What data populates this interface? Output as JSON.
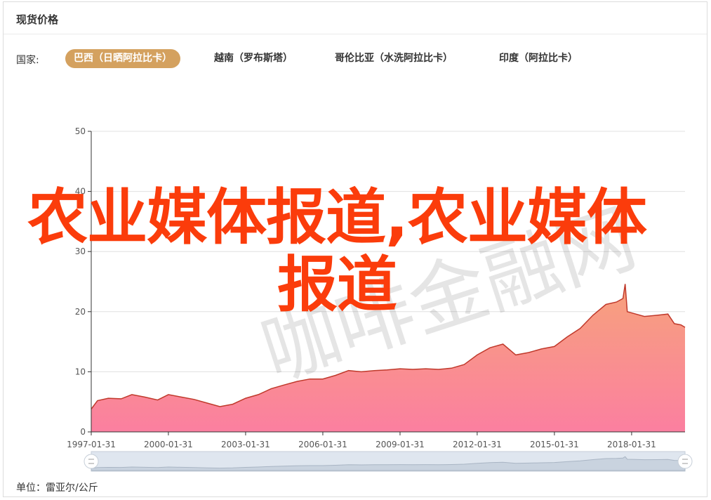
{
  "header": {
    "title": "现货价格"
  },
  "filters": {
    "label": "国家:",
    "tabs": [
      {
        "label": "巴西（日晒阿拉比卡）",
        "active": true
      },
      {
        "label": "越南（罗布斯塔）",
        "active": false
      },
      {
        "label": "哥伦比亚（水洗阿拉比卡）",
        "active": false
      },
      {
        "label": "印度（阿拉比卡）",
        "active": false
      }
    ]
  },
  "footer": {
    "unit": "单位：雷亚尔/公斤"
  },
  "overlay_text": "农业媒体报道,农业媒体报道",
  "watermark_text": "咖啡金融网",
  "colors": {
    "accent": "#d4a15f",
    "area_top": "#f7a27c",
    "area_bottom": "#fb7fa0",
    "line": "#c0392b",
    "overlay": "#fb3c0b"
  },
  "chart_data": {
    "type": "area",
    "ylim": [
      0,
      50
    ],
    "yticks": [
      0,
      10,
      20,
      30,
      40,
      50
    ],
    "xticks": [
      "1997-01-31",
      "2000-01-31",
      "2003-01-31",
      "2006-01-31",
      "2009-01-31",
      "2012-01-31",
      "2015-01-31",
      "2018-01-31"
    ],
    "xlim": [
      "1997-01-31",
      "2020-02-28"
    ],
    "grid": true,
    "points": [
      [
        "1997-01-31",
        3.8
      ],
      [
        "1997-04-30",
        5.2
      ],
      [
        "1997-09-30",
        5.6
      ],
      [
        "1998-03-31",
        5.5
      ],
      [
        "1998-08-31",
        6.2
      ],
      [
        "1999-02-28",
        5.8
      ],
      [
        "1999-08-31",
        5.3
      ],
      [
        "2000-01-31",
        6.2
      ],
      [
        "2000-07-31",
        5.8
      ],
      [
        "2001-01-31",
        5.4
      ],
      [
        "2001-07-31",
        4.8
      ],
      [
        "2002-01-31",
        4.2
      ],
      [
        "2002-07-31",
        4.6
      ],
      [
        "2003-01-31",
        5.6
      ],
      [
        "2003-07-31",
        6.2
      ],
      [
        "2004-01-31",
        7.2
      ],
      [
        "2004-07-31",
        7.8
      ],
      [
        "2005-01-31",
        8.4
      ],
      [
        "2005-07-31",
        8.8
      ],
      [
        "2006-01-31",
        8.8
      ],
      [
        "2006-07-31",
        9.4
      ],
      [
        "2007-01-31",
        10.2
      ],
      [
        "2007-07-31",
        10.0
      ],
      [
        "2008-01-31",
        10.2
      ],
      [
        "2008-07-31",
        10.3
      ],
      [
        "2009-01-31",
        10.5
      ],
      [
        "2009-07-31",
        10.4
      ],
      [
        "2010-01-31",
        10.5
      ],
      [
        "2010-07-31",
        10.4
      ],
      [
        "2011-01-31",
        10.6
      ],
      [
        "2011-07-31",
        11.2
      ],
      [
        "2012-01-31",
        12.8
      ],
      [
        "2012-07-31",
        14.0
      ],
      [
        "2013-01-31",
        14.6
      ],
      [
        "2013-07-31",
        12.8
      ],
      [
        "2014-01-31",
        13.2
      ],
      [
        "2014-07-31",
        13.8
      ],
      [
        "2015-01-31",
        14.2
      ],
      [
        "2015-07-31",
        15.8
      ],
      [
        "2016-01-31",
        17.2
      ],
      [
        "2016-07-31",
        19.4
      ],
      [
        "2017-01-31",
        21.2
      ],
      [
        "2017-06-30",
        21.6
      ],
      [
        "2017-09-30",
        22.2
      ],
      [
        "2017-10-31",
        24.6
      ],
      [
        "2017-11-30",
        20.0
      ],
      [
        "2018-03-31",
        19.6
      ],
      [
        "2018-07-31",
        19.2
      ],
      [
        "2019-01-31",
        19.4
      ],
      [
        "2019-06-30",
        19.6
      ],
      [
        "2019-09-30",
        18.0
      ],
      [
        "2019-12-31",
        17.8
      ],
      [
        "2020-02-28",
        17.4
      ]
    ]
  }
}
